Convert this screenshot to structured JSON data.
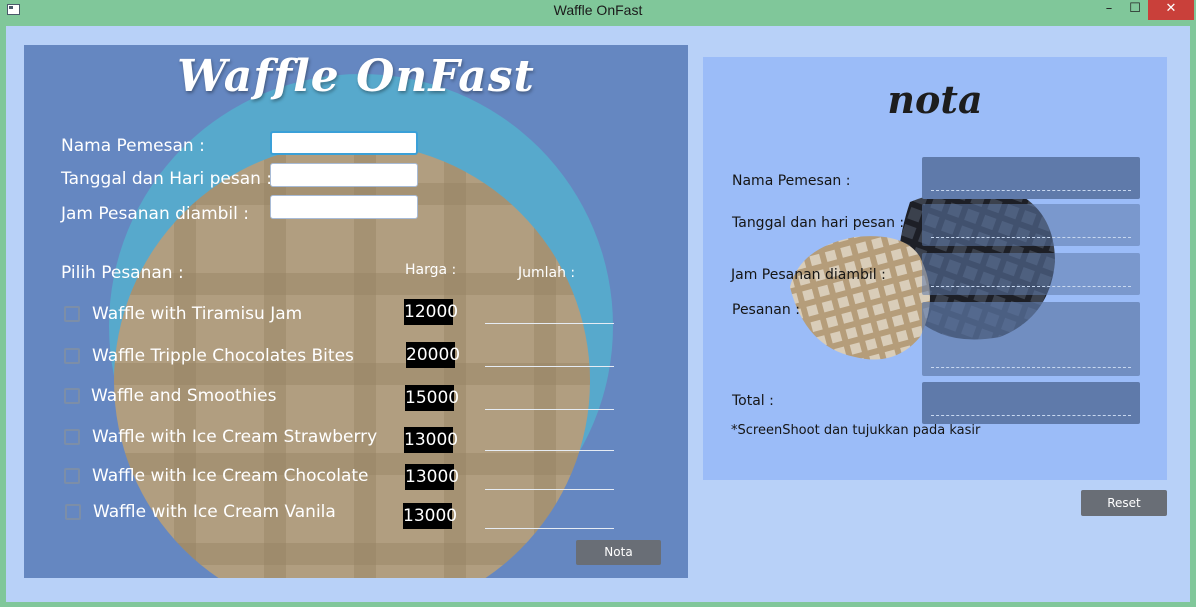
{
  "window": {
    "title": "Waffle OnFast",
    "minimize": "–",
    "maximize": "☐",
    "close": "✕"
  },
  "order_form": {
    "logo": "Waffle OnFast",
    "fields": [
      {
        "label": "Nama Pemesan :",
        "value": ""
      },
      {
        "label": "Tanggal dan Hari pesan :",
        "value": ""
      },
      {
        "label": "Jam Pesanan diambil :",
        "value": ""
      }
    ],
    "pick_label": "Pilih Pesanan :",
    "price_header": "Harga :",
    "qty_header": "Jumlah :",
    "items": [
      {
        "name": "Waffle with Tiramisu Jam",
        "price": "12000",
        "checked": false,
        "qty": ""
      },
      {
        "name": "Waffle Tripple Chocolates Bites",
        "price": "20000",
        "checked": false,
        "qty": ""
      },
      {
        "name": "Waffle and Smoothies",
        "price": "15000",
        "checked": false,
        "qty": ""
      },
      {
        "name": "Waffle with Ice Cream Strawberry",
        "price": "13000",
        "checked": false,
        "qty": ""
      },
      {
        "name": "Waffle with Ice Cream Chocolate",
        "price": "13000",
        "checked": false,
        "qty": ""
      },
      {
        "name": "Waffle with Ice Cream Vanila",
        "price": "13000",
        "checked": false,
        "qty": ""
      }
    ],
    "nota_button": "Nota"
  },
  "receipt": {
    "title": "nota",
    "fields": [
      {
        "label": "Nama Pemesan :",
        "value": ""
      },
      {
        "label": "Tanggal dan hari pesan :",
        "value": ""
      },
      {
        "label": "Jam Pesanan diambil :",
        "value": ""
      },
      {
        "label": "Pesanan :",
        "value": ""
      },
      {
        "label": "Total :",
        "value": ""
      }
    ],
    "note": "*ScreenShoot dan tujukkan pada kasir"
  },
  "reset_button": "Reset",
  "colors": {
    "title_bar": "#80c79a",
    "client_bg": "#b8d1f8",
    "left_panel": "#6587c1",
    "right_panel": "#9bbcf8",
    "close_button": "#c9403a",
    "button": "#696e76"
  }
}
